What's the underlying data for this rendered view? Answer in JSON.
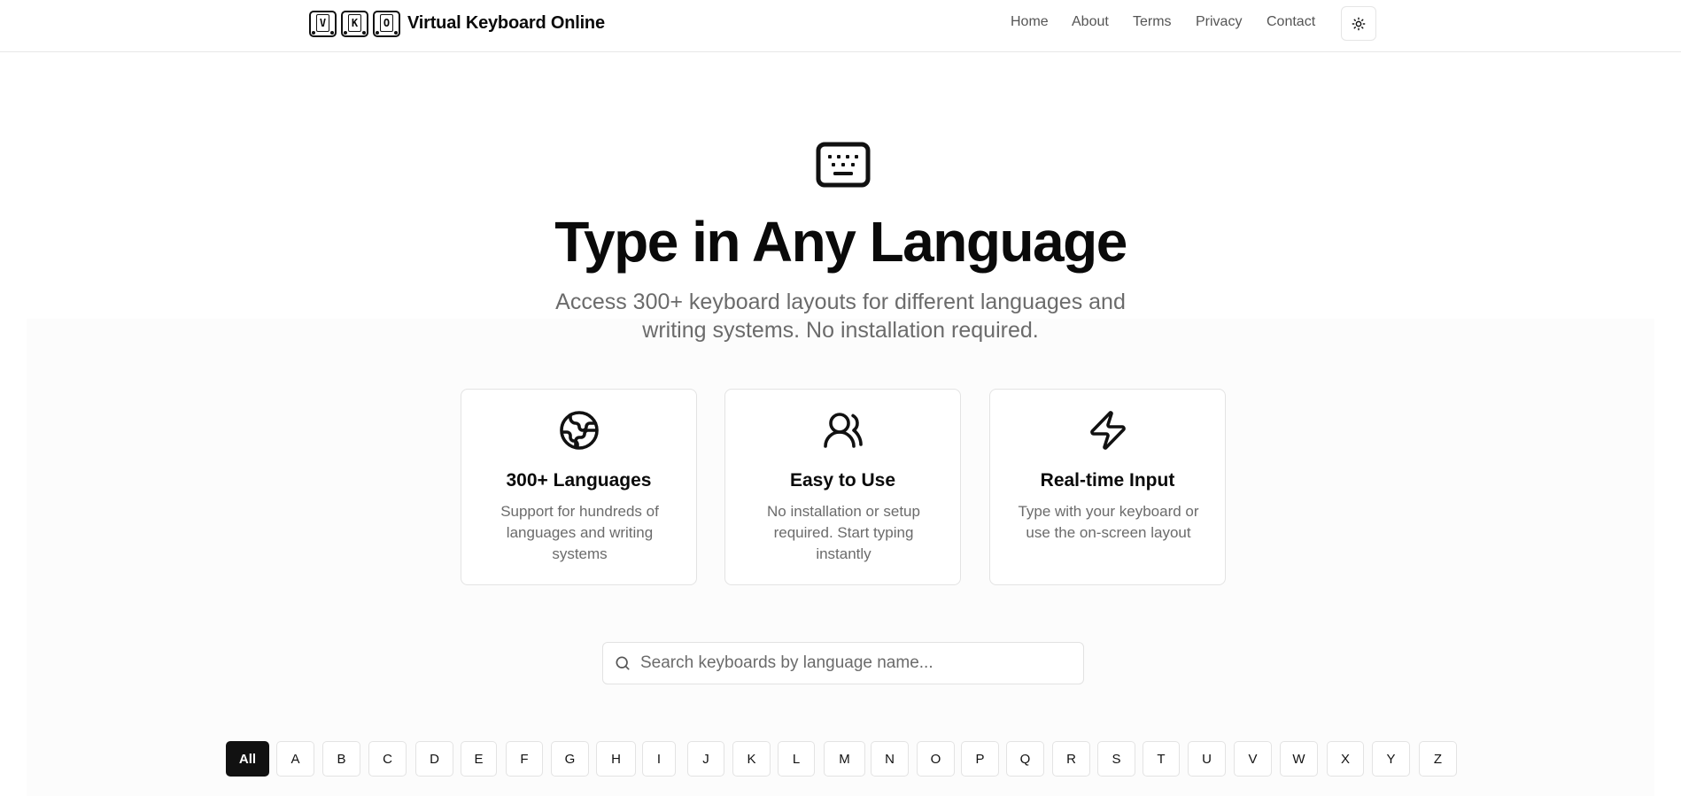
{
  "header": {
    "logo_keys": [
      "V",
      "K",
      "O"
    ],
    "title": "Virtual Keyboard Online",
    "nav": [
      {
        "label": "Home"
      },
      {
        "label": "About"
      },
      {
        "label": "Terms"
      },
      {
        "label": "Privacy"
      },
      {
        "label": "Contact"
      }
    ],
    "theme_icon": "sun-icon"
  },
  "hero": {
    "icon": "keyboard-icon",
    "title": "Type in Any Language",
    "subtitle": "Access 300+ keyboard layouts for different languages and writing systems. No installation required."
  },
  "features": [
    {
      "icon": "globe-icon",
      "title": "300+ Languages",
      "description": "Support for hundreds of languages and writing systems"
    },
    {
      "icon": "users-icon",
      "title": "Easy to Use",
      "description": "No installation or setup required. Start typing instantly"
    },
    {
      "icon": "lightning-icon",
      "title": "Real-time Input",
      "description": "Type with your keyboard or use the on-screen layout"
    }
  ],
  "search": {
    "placeholder": "Search keyboards by language name...",
    "value": ""
  },
  "alphabet_filter": {
    "selected": "All",
    "items": [
      "All",
      "A",
      "B",
      "C",
      "D",
      "E",
      "F",
      "G",
      "H",
      "I",
      "J",
      "K",
      "L",
      "M",
      "N",
      "O",
      "P",
      "Q",
      "R",
      "S",
      "T",
      "U",
      "V",
      "W",
      "X",
      "Y",
      "Z"
    ]
  },
  "colors": {
    "accent": "#111111",
    "text_muted": "#6b6b6b",
    "border": "#e3e3e3"
  }
}
